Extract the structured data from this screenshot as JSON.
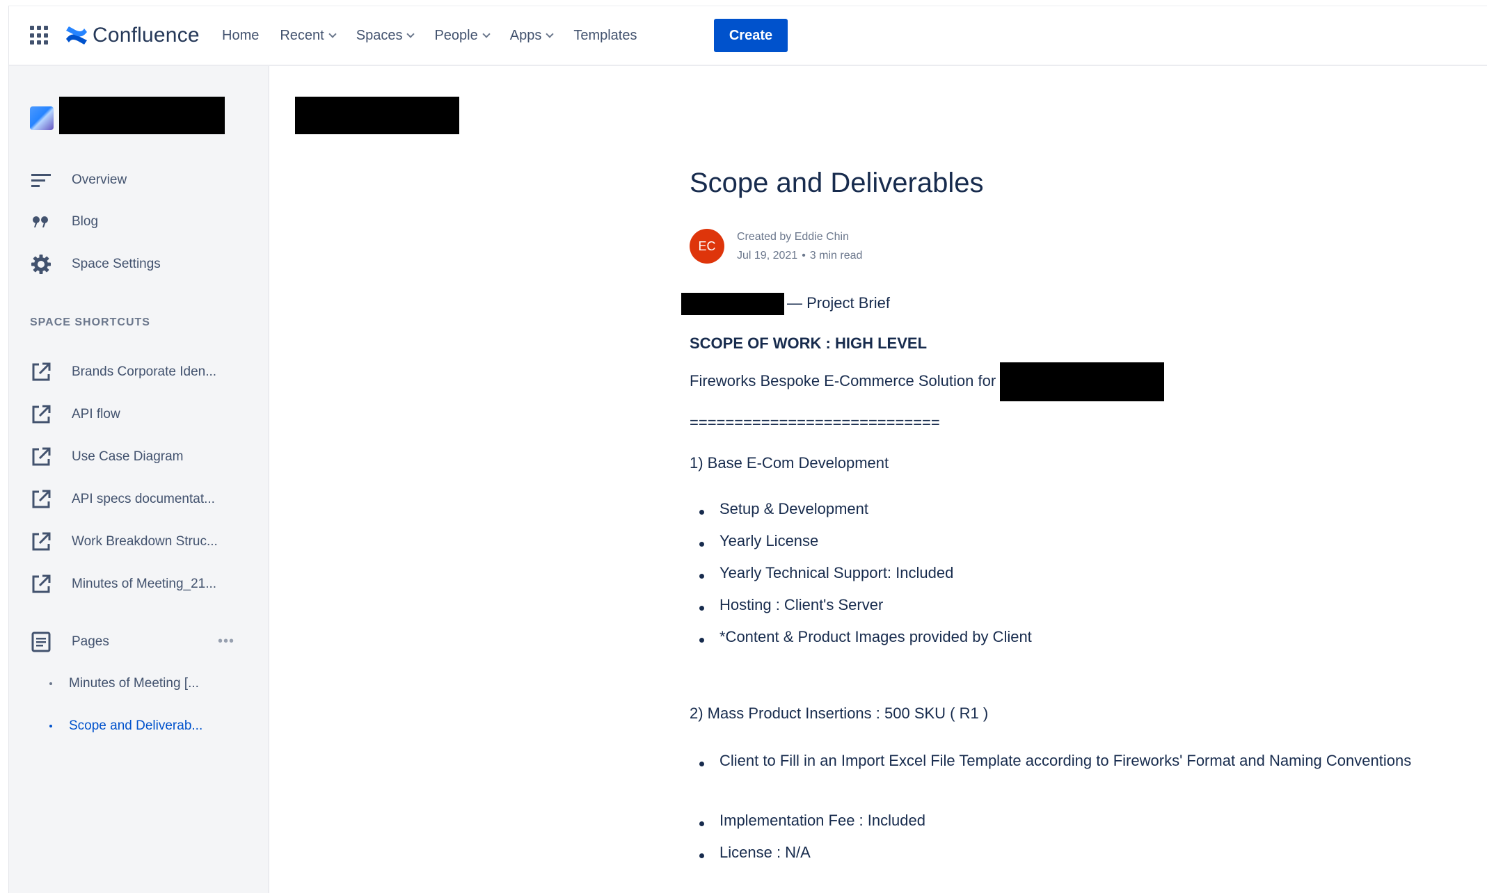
{
  "topbar": {
    "app_name": "Confluence",
    "nav": [
      {
        "label": "Home",
        "dropdown": false
      },
      {
        "label": "Recent",
        "dropdown": true
      },
      {
        "label": "Spaces",
        "dropdown": true
      },
      {
        "label": "People",
        "dropdown": true
      },
      {
        "label": "Apps",
        "dropdown": true
      },
      {
        "label": "Templates",
        "dropdown": false
      }
    ],
    "create_label": "Create",
    "accent": "#0052cc"
  },
  "sidebar": {
    "items": [
      {
        "label": "Overview",
        "icon": "overview-lines-icon"
      },
      {
        "label": "Blog",
        "icon": "quote-icon"
      },
      {
        "label": "Space Settings",
        "icon": "gear-icon"
      }
    ],
    "shortcuts_heading": "SPACE SHORTCUTS",
    "shortcuts": [
      {
        "label": "Brands Corporate Iden...",
        "icon": "external-link-icon"
      },
      {
        "label": "API flow",
        "icon": "external-link-icon"
      },
      {
        "label": "Use Case Diagram",
        "icon": "external-link-icon"
      },
      {
        "label": "API specs documentat...",
        "icon": "external-link-icon"
      },
      {
        "label": "Work Breakdown Struc...",
        "icon": "external-link-icon"
      },
      {
        "label": "Minutes of Meeting_21...",
        "icon": "external-link-icon"
      }
    ],
    "pages_label": "Pages",
    "pages_more": "•••",
    "page_tree": [
      {
        "label": "Minutes of Meeting [...",
        "active": false
      },
      {
        "label": "Scope and Deliverab...",
        "active": true
      }
    ]
  },
  "page": {
    "title": "Scope and Deliverables",
    "author_initials": "EC",
    "author_color": "#de350b",
    "created_by": "Created by Eddie Chin",
    "date": "Jul 19, 2021",
    "read_time": "3 min read",
    "brief_suffix": "— Project Brief",
    "scope_heading": "SCOPE OF WORK : HIGH LEVEL",
    "solution_line": "Fireworks Bespoke E-Commerce Solution for",
    "separator": "============================",
    "section1": {
      "heading": "1) Base E-Com Development",
      "bullets": [
        "Setup & Development",
        "Yearly License",
        "Yearly Technical Support: Included",
        "Hosting : Client's Server",
        "*Content & Product Images provided by Client"
      ]
    },
    "section2": {
      "heading": "2) Mass Product Insertions : 500 SKU ( R1 )",
      "bullets": [
        "Client to Fill in an Import Excel File Template according to Fireworks' Format and Naming Conventions",
        "Implementation Fee : Included",
        "License : N/A"
      ]
    }
  }
}
